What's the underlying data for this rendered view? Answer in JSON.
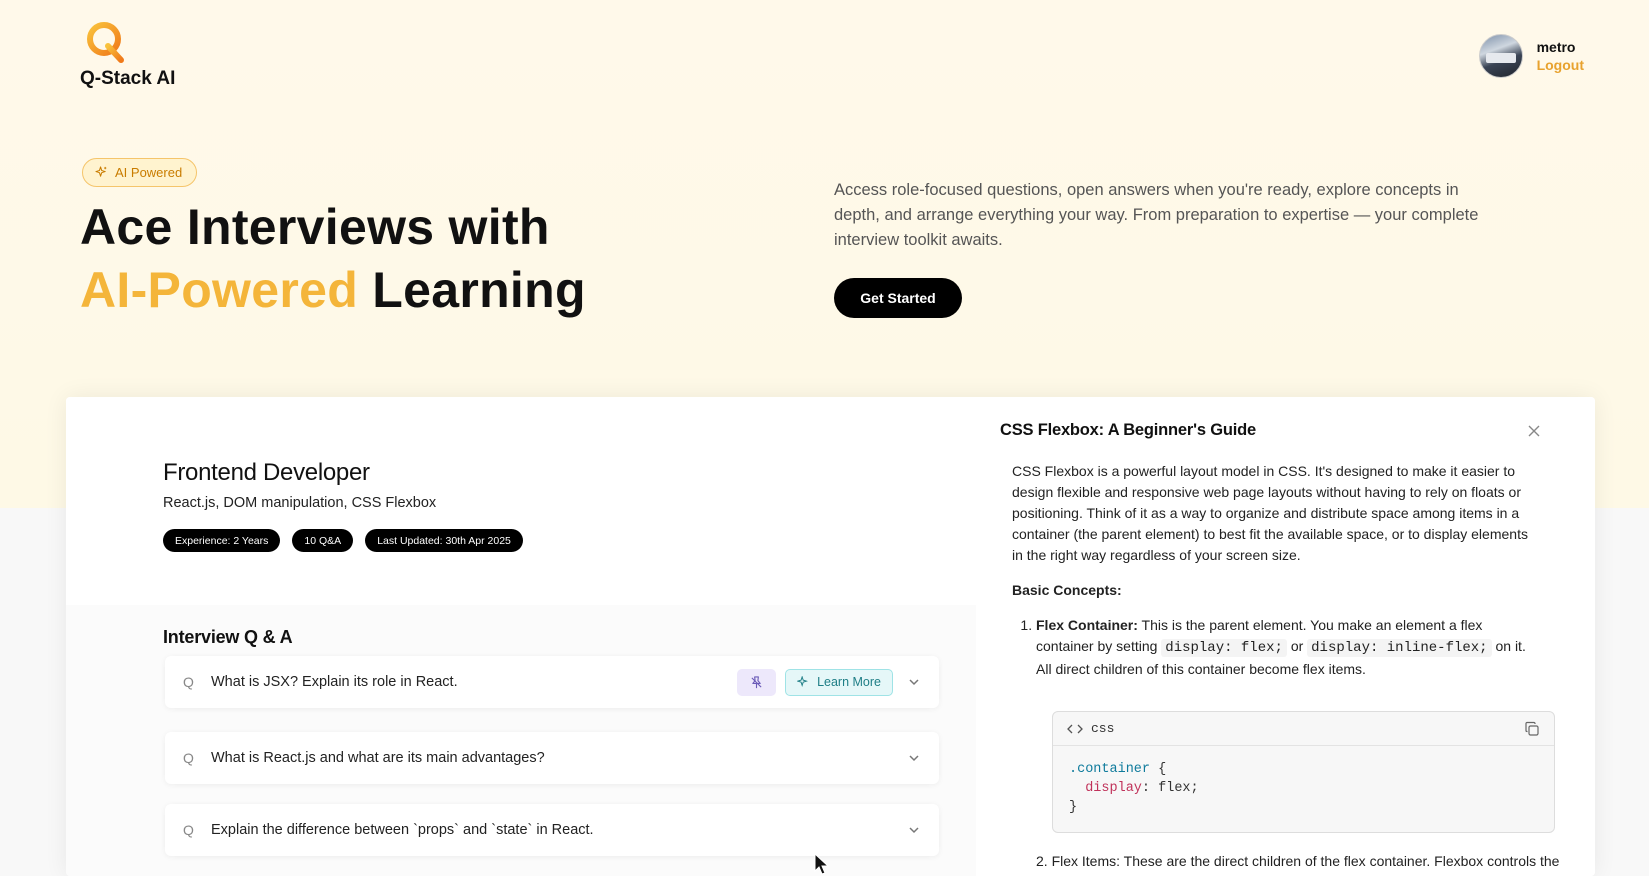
{
  "header": {
    "logo_text": "Q-Stack AI",
    "user_name": "metro",
    "logout_label": "Logout"
  },
  "hero": {
    "badge_label": "AI Powered",
    "title_line1": "Ace Interviews with",
    "title_accent": "AI-Powered",
    "title_rest": "Learning",
    "description": "Access role-focused questions, open answers when you're ready, explore concepts in depth, and arrange everything your way. From preparation to expertise — your complete interview toolkit awaits.",
    "cta_label": "Get Started"
  },
  "preview": {
    "role_title": "Frontend Developer",
    "role_topics": "React.js, DOM manipulation, CSS Flexbox",
    "pills": {
      "experience": "Experience: 2 Years",
      "count": "10 Q&A",
      "updated": "Last Updated: 30th Apr 2025"
    },
    "qa_heading": "Interview Q & A",
    "q_prefix": "Q",
    "questions": [
      {
        "text": "What is JSX? Explain its role in React."
      },
      {
        "text": "What is React.js and what are its main advantages?"
      },
      {
        "text": "Explain the difference between `props` and `state` in React."
      }
    ],
    "learn_more_label": "Learn More"
  },
  "side_panel": {
    "title": "CSS Flexbox: A Beginner's Guide",
    "intro": "CSS Flexbox is a powerful layout model in CSS. It's designed to make it easier to design flexible and responsive web page layouts without having to rely on floats or positioning. Think of it as a way to organize and distribute space among items in a container (the parent element) to best fit the available space, or to display elements in the right way regardless of your screen size.",
    "concepts_heading": "Basic Concepts:",
    "item1_term": "Flex Container:",
    "item1_text_a": "This is the parent element. You make an element a flex container by setting",
    "item1_code1": "display: flex;",
    "item1_text_b": "or",
    "item1_code2": "display: inline-flex;",
    "item1_text_c": "on it. All direct children of this container become flex items.",
    "code_lang": "css",
    "code_selector": ".container",
    "code_open": " {",
    "code_prop": "display",
    "code_value": ": flex;",
    "code_close": "}",
    "cutoff_text": "2. Flex Items: These are the direct children of the flex container. Flexbox controls the"
  }
}
